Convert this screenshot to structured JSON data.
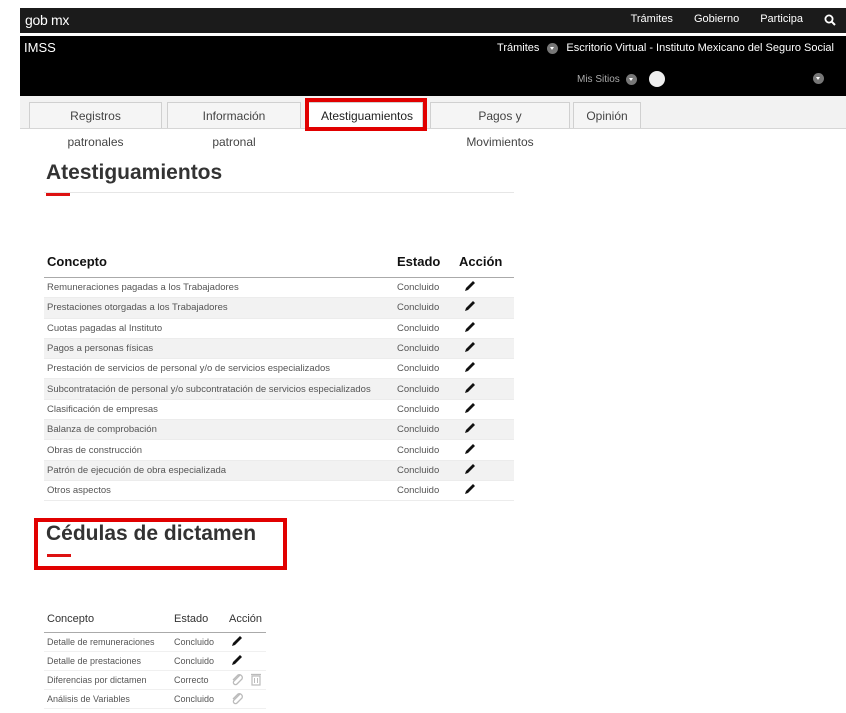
{
  "gob": {
    "logo": "gob mx",
    "nav": [
      "Trámites",
      "Gobierno",
      "Participa"
    ]
  },
  "imss": {
    "title": "IMSS",
    "tramites": "Trámites",
    "escritorio": "Escritorio Virtual - Instituto Mexicano del Seguro Social",
    "mis_sitios": "Mis Sitios"
  },
  "tabs": [
    {
      "label": "Registros patronales"
    },
    {
      "label": "Información patronal"
    },
    {
      "label": "Atestiguamientos"
    },
    {
      "label": "Pagos y Movimientos"
    },
    {
      "label": "Opinión"
    }
  ],
  "atestiguamientos": {
    "heading": "Atestiguamientos",
    "columns": [
      "Concepto",
      "Estado",
      "Acción"
    ],
    "rows": [
      {
        "concepto": "Remuneraciones pagadas a los Trabajadores",
        "estado": "Concluido"
      },
      {
        "concepto": "Prestaciones otorgadas a los Trabajadores",
        "estado": "Concluido"
      },
      {
        "concepto": "Cuotas pagadas al Instituto",
        "estado": "Concluido"
      },
      {
        "concepto": "Pagos a personas físicas",
        "estado": "Concluido"
      },
      {
        "concepto": "Prestación de servicios de personal y/o de servicios especializados",
        "estado": "Concluido"
      },
      {
        "concepto": "Subcontratación de personal y/o subcontratación de servicios especializados",
        "estado": "Concluido"
      },
      {
        "concepto": "Clasificación de empresas",
        "estado": "Concluido"
      },
      {
        "concepto": "Balanza de comprobación",
        "estado": "Concluido"
      },
      {
        "concepto": "Obras de construcción",
        "estado": "Concluido"
      },
      {
        "concepto": "Patrón de ejecución de obra especializada",
        "estado": "Concluido"
      },
      {
        "concepto": "Otros aspectos",
        "estado": "Concluido"
      }
    ]
  },
  "cedulas": {
    "heading": "Cédulas de dictamen",
    "columns": [
      "Concepto",
      "Estado",
      "Acción"
    ],
    "rows": [
      {
        "concepto": "Detalle de remuneraciones",
        "estado": "Concluido"
      },
      {
        "concepto": "Detalle de prestaciones",
        "estado": "Concluido"
      },
      {
        "concepto": "Diferencias por dictamen",
        "estado": "Correcto"
      },
      {
        "concepto": "Análisis de Variables",
        "estado": "Concluido"
      }
    ]
  }
}
